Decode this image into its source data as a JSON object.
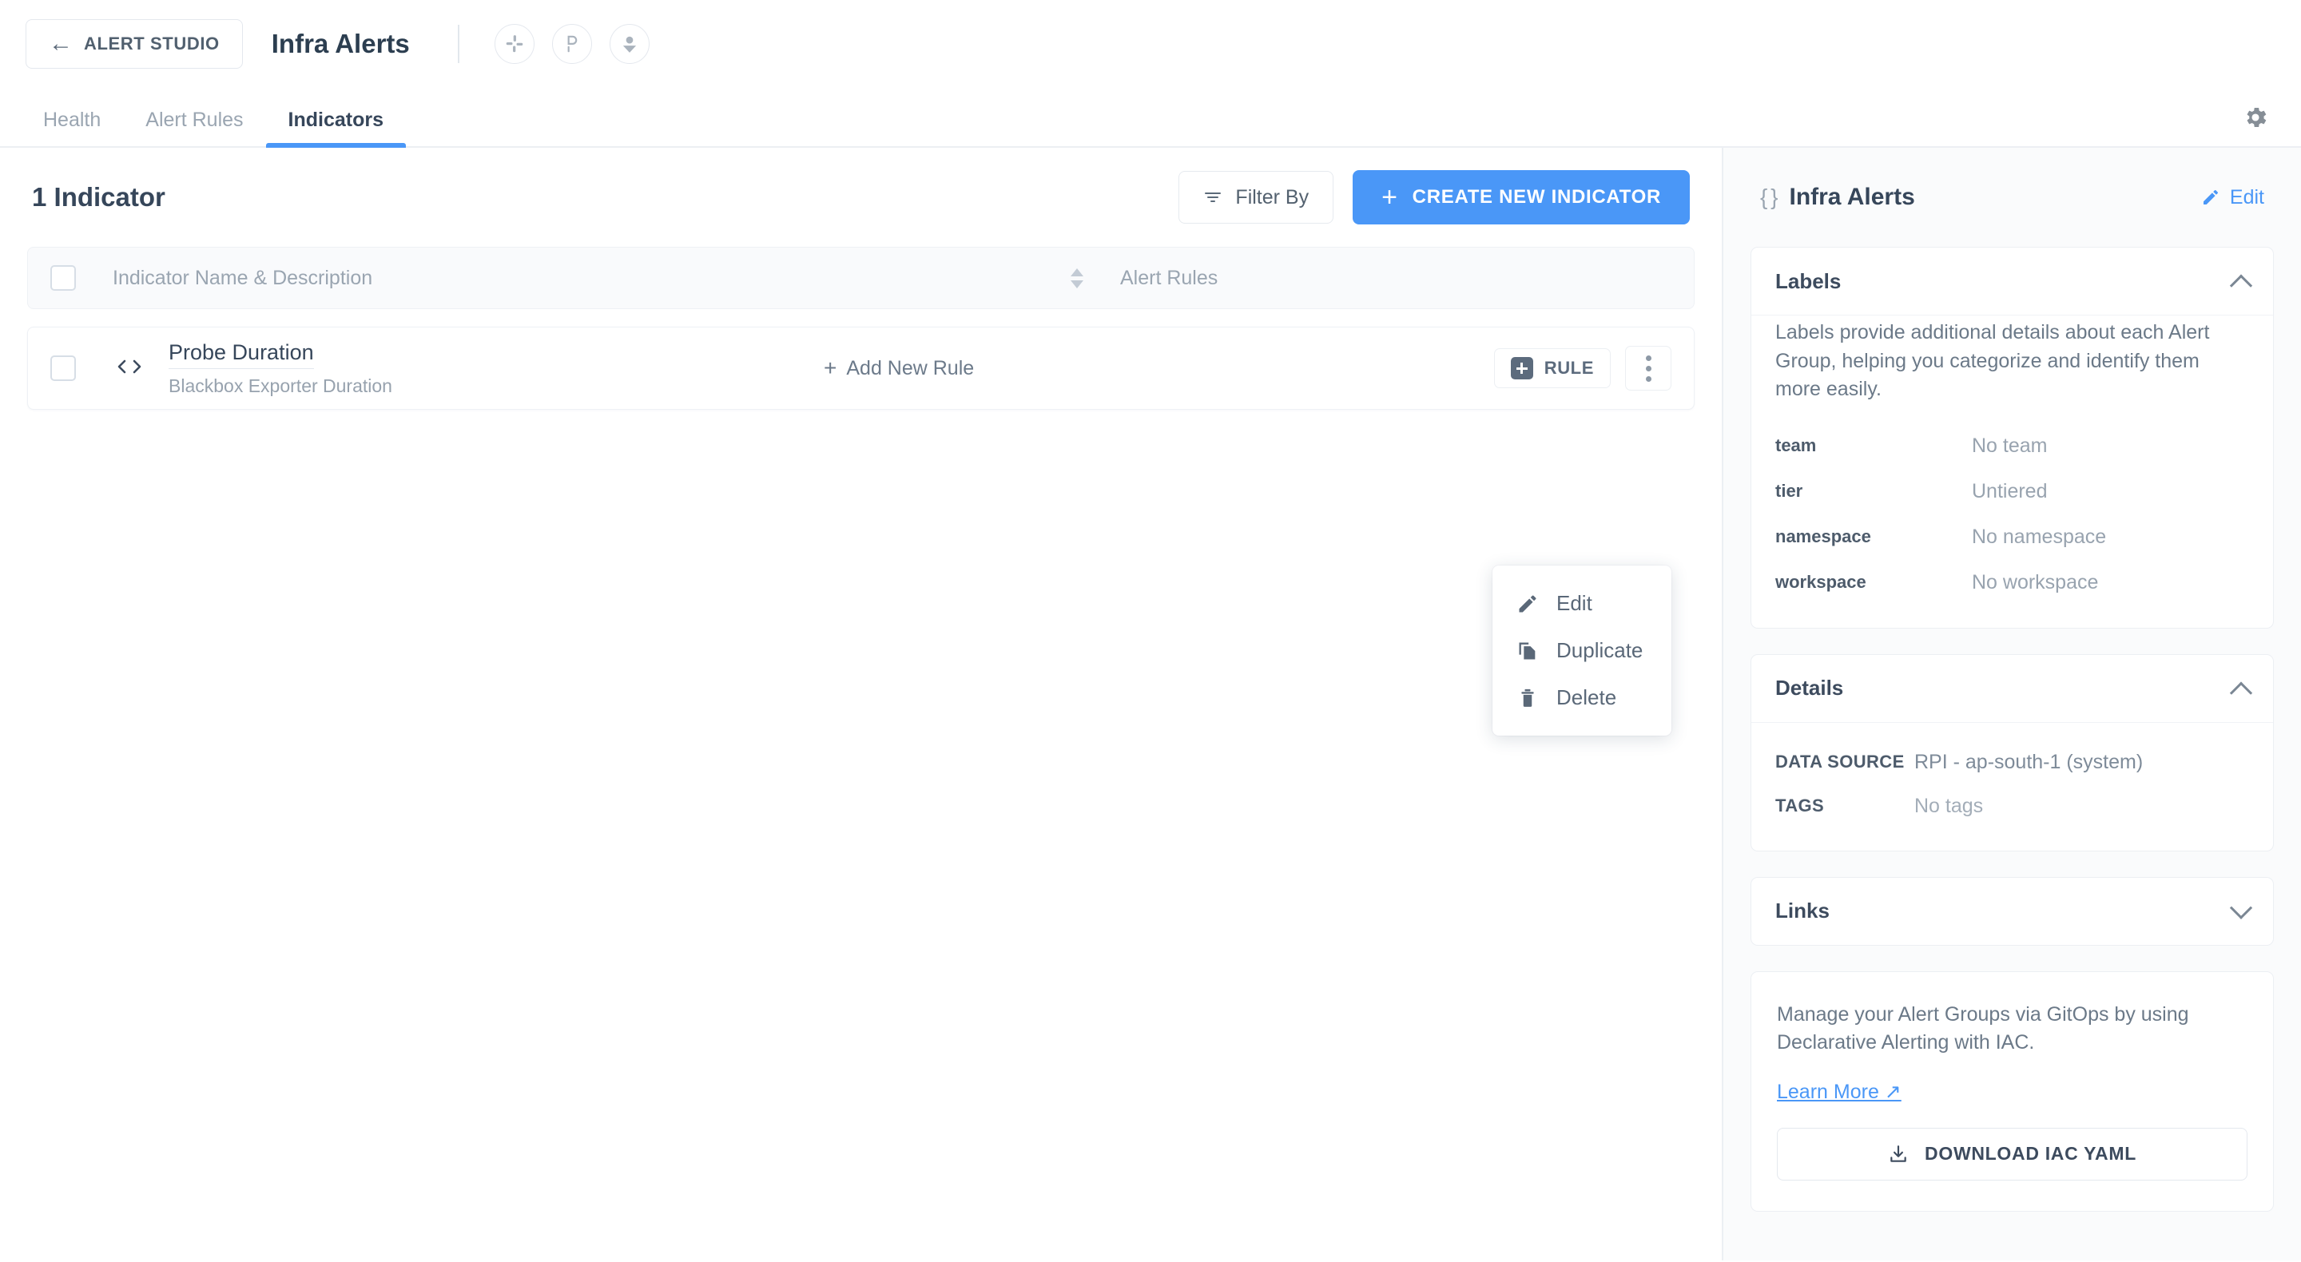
{
  "topbar": {
    "back_label": "ALERT STUDIO",
    "back_arrow": "←",
    "app_title": "Infra Alerts",
    "integrations": [
      {
        "name": "slack-icon",
        "label": "Slack"
      },
      {
        "name": "pagerduty-icon",
        "label": "PagerDuty"
      },
      {
        "name": "user-icon",
        "label": "Owner"
      }
    ]
  },
  "tabs": [
    {
      "label": "Health",
      "active": false
    },
    {
      "label": "Alert Rules",
      "active": false
    },
    {
      "label": "Indicators",
      "active": true
    }
  ],
  "settings_icon": "gear-icon",
  "main": {
    "count_title": "1 Indicator",
    "filter_label": "Filter By",
    "create_label": "CREATE NEW INDICATOR",
    "create_plus": "+",
    "table": {
      "columns": [
        "Indicator Name & Description",
        "Alert Rules"
      ],
      "rows": [
        {
          "name": "Probe Duration",
          "description": "Blackbox Exporter Duration",
          "add_rule_label": "Add New Rule",
          "add_rule_plus": "+",
          "rule_badge_label": "RULE"
        }
      ]
    },
    "context_menu": [
      {
        "label": "Edit",
        "icon": "pencil-icon"
      },
      {
        "label": "Duplicate",
        "icon": "copy-icon"
      },
      {
        "label": "Delete",
        "icon": "trash-icon"
      }
    ]
  },
  "sidebar": {
    "title": "Infra Alerts",
    "braces": "{ }",
    "edit_label": "Edit",
    "labels_section": {
      "title": "Labels",
      "description": "Labels provide additional details about each Alert Group, helping you categorize and identify them more easily.",
      "items": [
        {
          "key": "team",
          "value": "No team"
        },
        {
          "key": "tier",
          "value": "Untiered"
        },
        {
          "key": "namespace",
          "value": "No namespace"
        },
        {
          "key": "workspace",
          "value": "No workspace"
        }
      ]
    },
    "details_section": {
      "title": "Details",
      "items": [
        {
          "key": "DATA SOURCE",
          "value": "RPI - ap-south-1 (system)"
        },
        {
          "key": "TAGS",
          "value": "No tags"
        }
      ]
    },
    "links_section": {
      "title": "Links"
    },
    "iac": {
      "text": "Manage your Alert Groups via GitOps by using Declarative Alerting with IAC.",
      "learn_more": "Learn More ↗",
      "download_label": "DOWNLOAD IAC YAML"
    }
  },
  "colors": {
    "accent": "#4a97f7",
    "text_dark": "#36465a",
    "text_muted": "#98a3af",
    "border": "#eceff3",
    "sidebar_bg": "#fafbfc"
  }
}
